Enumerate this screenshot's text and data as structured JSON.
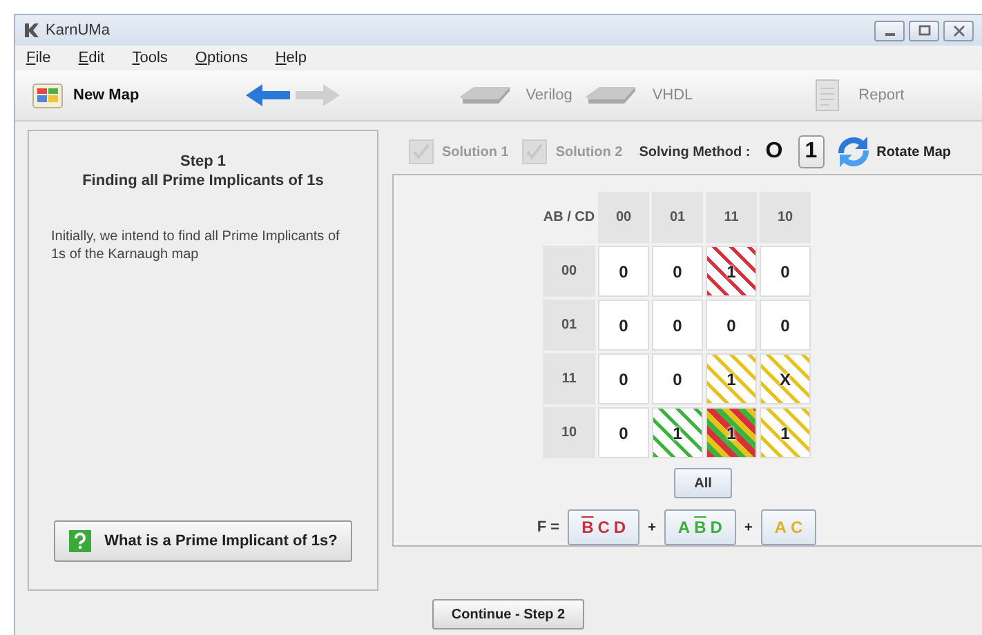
{
  "window": {
    "title": "KarnUMa"
  },
  "menu": [
    {
      "label": "File"
    },
    {
      "label": "Edit"
    },
    {
      "label": "Tools"
    },
    {
      "label": "Options"
    },
    {
      "label": "Help"
    }
  ],
  "toolbar": [
    {
      "kind": "newmap",
      "label": "New Map",
      "disabled": false
    },
    {
      "kind": "back",
      "disabled": false
    },
    {
      "kind": "forward",
      "disabled": true
    },
    {
      "kind": "chip",
      "label": "Verilog",
      "disabled": true
    },
    {
      "kind": "chip",
      "label": "VHDL",
      "disabled": true
    },
    {
      "kind": "report",
      "label": "Report",
      "disabled": true
    }
  ],
  "step": {
    "title": "Step 1",
    "subtitle": "Finding all Prime Implicants of 1s",
    "description": "Initially, we intend to find all Prime Implicants of 1s of the Karnaugh map",
    "help_button": "What is a Prime Implicant of 1s?"
  },
  "options": {
    "solutions": [
      {
        "label": "Solution 1",
        "checked": true,
        "disabled": true
      },
      {
        "label": "Solution 2",
        "checked": true,
        "disabled": true
      }
    ],
    "solving_method": {
      "label": "Solving Method :",
      "choices": [
        {
          "label": "O",
          "selected": false
        },
        {
          "label": "1",
          "selected": true
        }
      ]
    },
    "rotate_button": "Rotate Map"
  },
  "kmap": {
    "corner": "AB / CD",
    "columns": [
      "00",
      "01",
      "11",
      "10"
    ],
    "rows": [
      {
        "label": "00",
        "cells": [
          {
            "value": "0"
          },
          {
            "value": "0"
          },
          {
            "value": "1",
            "stripes": [
              {
                "color": "#d8303c"
              }
            ]
          },
          {
            "value": "0"
          }
        ]
      },
      {
        "label": "01",
        "cells": [
          {
            "value": "0"
          },
          {
            "value": "0"
          },
          {
            "value": "0"
          },
          {
            "value": "0"
          }
        ]
      },
      {
        "label": "11",
        "cells": [
          {
            "value": "0"
          },
          {
            "value": "0"
          },
          {
            "value": "1",
            "stripes": [
              {
                "color": "#e8c21c"
              }
            ]
          },
          {
            "value": "X",
            "stripes": [
              {
                "color": "#e8c21c"
              }
            ]
          }
        ]
      },
      {
        "label": "10",
        "cells": [
          {
            "value": "0"
          },
          {
            "value": "1",
            "stripes": [
              {
                "color": "#3cb43c"
              }
            ]
          },
          {
            "value": "1",
            "stripes": [
              {
                "color": "#d8303c"
              },
              {
                "color": "#3cb43c"
              },
              {
                "color": "#e8c21c"
              }
            ]
          },
          {
            "value": "1",
            "stripes": [
              {
                "color": "#e8c21c"
              }
            ]
          }
        ]
      }
    ]
  },
  "all_button": "All",
  "function": {
    "label": "F =",
    "operators": [
      "+",
      "+"
    ],
    "terms": [
      {
        "color": "#c8303c",
        "literals": [
          {
            "letter": "B",
            "negated": true
          },
          {
            "letter": "C",
            "negated": false
          },
          {
            "letter": "D",
            "negated": false
          }
        ]
      },
      {
        "color": "#3cac3c",
        "literals": [
          {
            "letter": "A",
            "negated": false
          },
          {
            "letter": "B",
            "negated": true
          },
          {
            "letter": "D",
            "negated": false
          }
        ]
      },
      {
        "color": "#e0b020",
        "literals": [
          {
            "letter": "A",
            "negated": false
          },
          {
            "letter": "C",
            "negated": false
          }
        ]
      }
    ]
  },
  "continue_button": "Continue - Step 2"
}
